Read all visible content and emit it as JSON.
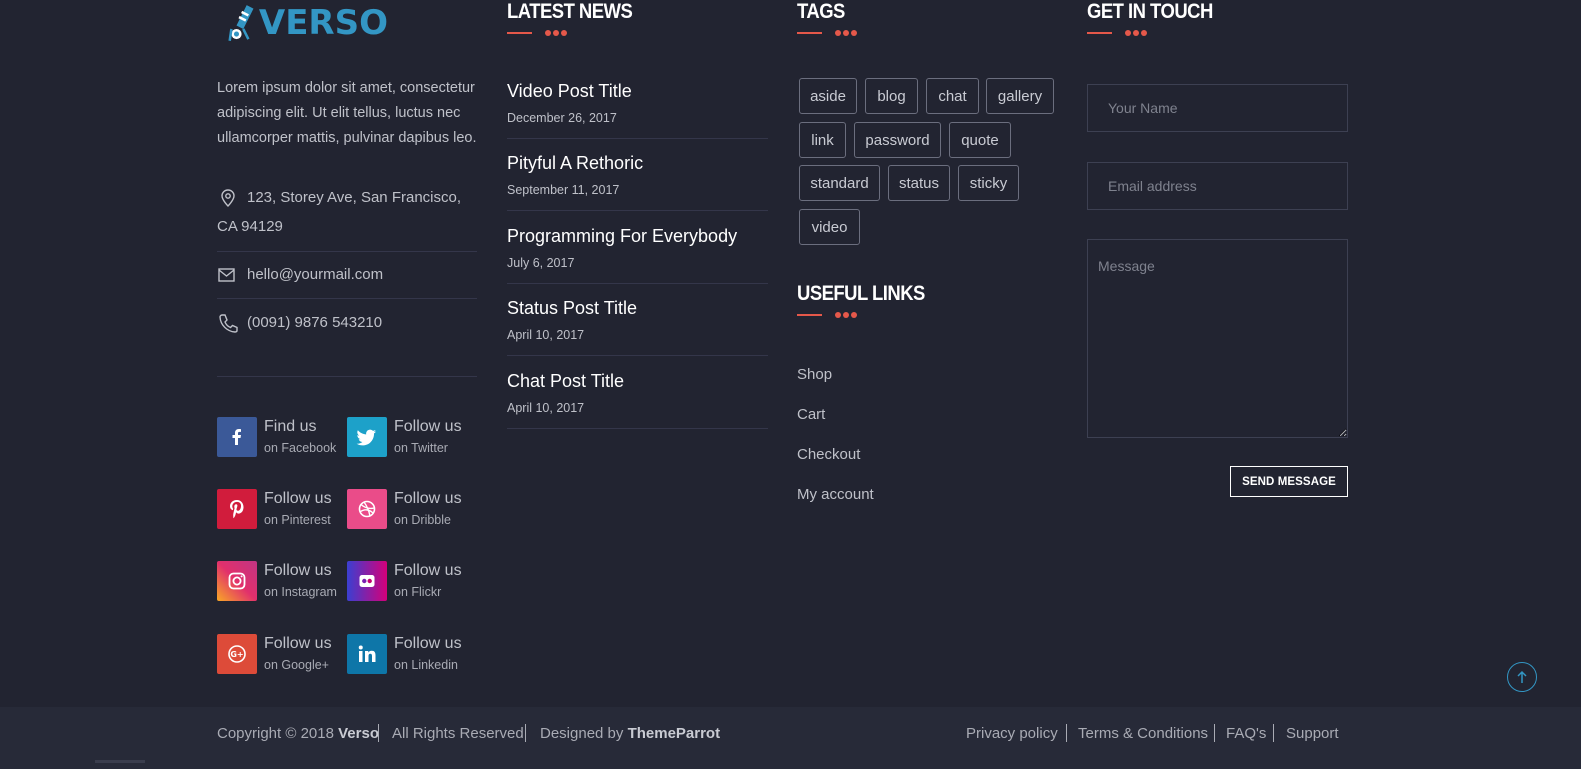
{
  "brand": {
    "logo_text": "VERSO",
    "logo_color": "#3396c4"
  },
  "about": {
    "text": "Lorem ipsum dolor sit amet, consectetur adipiscing elit. Ut elit tellus, luctus nec ullamcorper mattis, pulvinar dapibus leo.",
    "address": "123, Storey Ave, San Francisco, CA 94129",
    "email": "hello@yourmail.com",
    "phone": "(0091) 9876 543210"
  },
  "social": [
    {
      "line1": "Find us",
      "line2": "on Facebook",
      "icon": "facebook-icon",
      "color": "#3b5998"
    },
    {
      "line1": "Follow us",
      "line2": "on Twitter",
      "icon": "twitter-icon",
      "color": "#1da1c9"
    },
    {
      "line1": "Follow us",
      "line2": "on Pinterest",
      "icon": "pinterest-icon",
      "color": "#d11c3c"
    },
    {
      "line1": "Follow us",
      "line2": "on Dribble",
      "icon": "dribbble-icon",
      "color": "#ea4c89"
    },
    {
      "line1": "Follow us",
      "line2": "on Instagram",
      "icon": "instagram-icon",
      "color": "#e1306c"
    },
    {
      "line1": "Follow us",
      "line2": "on Flickr",
      "icon": "flickr-icon",
      "color": "#d4007a"
    },
    {
      "line1": "Follow us",
      "line2": "on Google+",
      "icon": "google-plus-icon",
      "color": "#dd4b39"
    },
    {
      "line1": "Follow us",
      "line2": "on Linkedin",
      "icon": "linkedin-icon",
      "color": "#0e76a8"
    }
  ],
  "news": {
    "heading": "LATEST NEWS",
    "items": [
      {
        "title": "Video Post Title",
        "date": "December 26, 2017"
      },
      {
        "title": "Pityful A Rethoric",
        "date": "September 11, 2017"
      },
      {
        "title": "Programming For Everybody",
        "date": "July 6, 2017"
      },
      {
        "title": "Status Post Title",
        "date": "April 10, 2017"
      },
      {
        "title": "Chat Post Title",
        "date": "April 10, 2017"
      }
    ]
  },
  "tags": {
    "heading": "TAGS",
    "items": [
      "aside",
      "blog",
      "chat",
      "gallery",
      "link",
      "password",
      "quote",
      "standard",
      "status",
      "sticky",
      "video"
    ]
  },
  "links": {
    "heading": "USEFUL LINKS",
    "items": [
      "Shop",
      "Cart",
      "Checkout",
      "My account"
    ]
  },
  "contact": {
    "heading": "GET IN TOUCH",
    "name_placeholder": "Your Name",
    "email_placeholder": "Email address",
    "message_placeholder": "Message",
    "send_label": "SEND MESSAGE"
  },
  "footer": {
    "copyright_prefix": "Copyright © 2018",
    "brand": "Verso",
    "rights": "All Rights Reserved",
    "designed_prefix": "Designed by",
    "designer": "ThemeParrot",
    "links": [
      "Privacy policy",
      "Terms & Conditions",
      "FAQ's",
      "Support"
    ]
  },
  "accent_color": "#e5584a"
}
